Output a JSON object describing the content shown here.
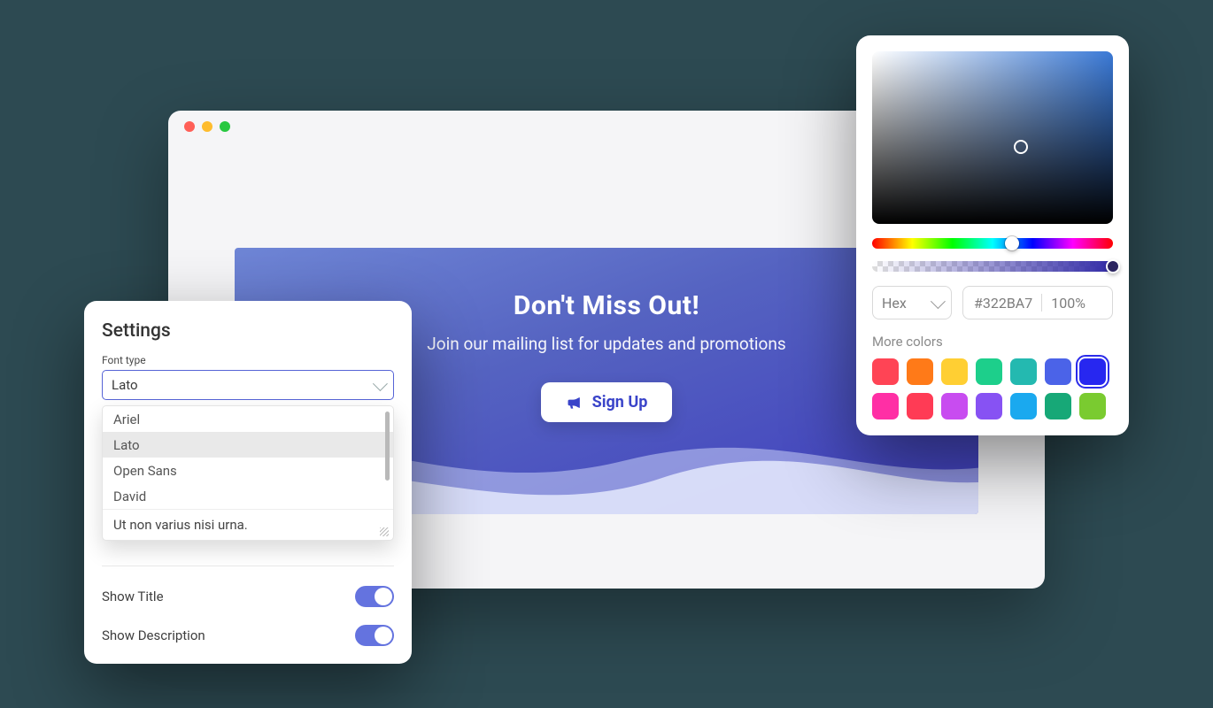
{
  "hero": {
    "title": "Don't Miss Out!",
    "subtitle": "Join our mailing list for updates and promotions",
    "cta": "Sign Up"
  },
  "settings": {
    "heading": "Settings",
    "font_label": "Font type",
    "font_selected": "Lato",
    "font_options": [
      "Ariel",
      "Lato",
      "Open Sans",
      "David"
    ],
    "font_hover_index": 1,
    "sample_text": "Ut non varius nisi urna.",
    "toggles": [
      {
        "label": "Show Title",
        "on": true
      },
      {
        "label": "Show Description",
        "on": true
      }
    ]
  },
  "picker": {
    "format_label": "Hex",
    "hex_value": "#322BA7",
    "alpha_value": "100%",
    "more_label": "More colors",
    "swatches": [
      "#ff4455",
      "#ff7a18",
      "#ffcf33",
      "#1dcf8b",
      "#24b9b0",
      "#4b63e8",
      "#2727f0",
      "#ff2fa5",
      "#ff3b55",
      "#c84cf0",
      "#8752f3",
      "#1aa9ef",
      "#17a877",
      "#7acb30"
    ],
    "selected_swatch_index": 6
  }
}
